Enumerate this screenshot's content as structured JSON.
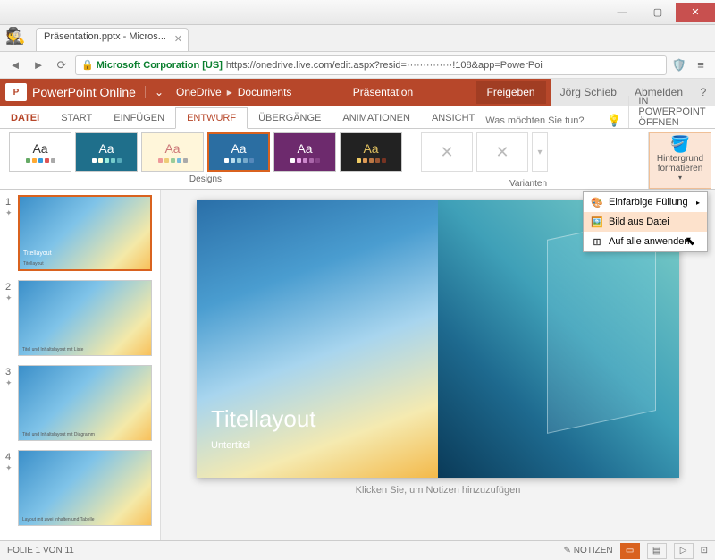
{
  "browser": {
    "tab_title": "Präsentation.pptx - Micros...",
    "secure_label": "Microsoft Corporation [US]",
    "url": "https://onedrive.live.com/edit.aspx?resid=··············!108&app=PowerPoi"
  },
  "app": {
    "logo": "P",
    "title": "PowerPoint Online",
    "breadcrumb": [
      "OneDrive",
      "Documents"
    ],
    "docname": "Präsentation",
    "share": "Freigeben",
    "user": "Jörg Schieb",
    "signout": "Abmelden"
  },
  "tabs": {
    "file": "DATEI",
    "home": "START",
    "insert": "EINFÜGEN",
    "design": "ENTWURF",
    "transitions": "ÜBERGÄNGE",
    "animations": "ANIMATIONEN",
    "view": "ANSICHT",
    "tellme_placeholder": "Was möchten Sie tun?",
    "open_desktop": "IN POWERPOINT ÖFFNEN"
  },
  "ribbon": {
    "designs_label": "Designs",
    "variants_label": "Varianten",
    "format_bg": "Hintergrund formatieren",
    "themes": [
      {
        "aa": "Aa",
        "bg": "#ffffff",
        "fg": "#333",
        "dots": [
          "#6a6",
          "#fa3",
          "#39d",
          "#d55",
          "#aaa"
        ]
      },
      {
        "aa": "Aa",
        "bg": "#1f6f8b",
        "fg": "#fff",
        "dots": [
          "#fff",
          "#ffd",
          "#9ed",
          "#7cc",
          "#5ab"
        ]
      },
      {
        "aa": "Aa",
        "bg": "#fff6da",
        "fg": "#c77",
        "dots": [
          "#e99",
          "#ec7",
          "#9c9",
          "#7bd",
          "#aaa"
        ]
      },
      {
        "aa": "Aa",
        "bg": "#2b6ea2",
        "fg": "#fff",
        "dots": [
          "#fff",
          "#bde",
          "#9cd",
          "#7ac",
          "#58b"
        ]
      },
      {
        "aa": "Aa",
        "bg": "#6d2a6d",
        "fg": "#fff",
        "dots": [
          "#fff",
          "#eae",
          "#c8c",
          "#a6a",
          "#848"
        ]
      },
      {
        "aa": "Aa",
        "bg": "#222222",
        "fg": "#e0c060",
        "dots": [
          "#ec6",
          "#d95",
          "#b74",
          "#953",
          "#732"
        ]
      }
    ]
  },
  "dropdown": {
    "solid_fill": "Einfarbige Füllung",
    "image_file": "Bild aus Datei",
    "apply_all": "Auf alle anwenden"
  },
  "thumbs": [
    {
      "n": "1",
      "caption": "Titellayout"
    },
    {
      "n": "2",
      "caption": "Titel und Inhaltslayout mit Liste"
    },
    {
      "n": "3",
      "caption": "Titel und Inhaltslayout mit Diagramm"
    },
    {
      "n": "4",
      "caption": "Layout mit zwei Inhalten und Tabelle"
    }
  ],
  "slide": {
    "title": "Titellayout",
    "subtitle": "Untertitel",
    "thumb_title": "Titellayout"
  },
  "notes_hint": "Klicken Sie, um Notizen hinzuzufügen",
  "status": {
    "left": "FOLIE 1 VON 11",
    "notes_btn": "NOTIZEN"
  }
}
